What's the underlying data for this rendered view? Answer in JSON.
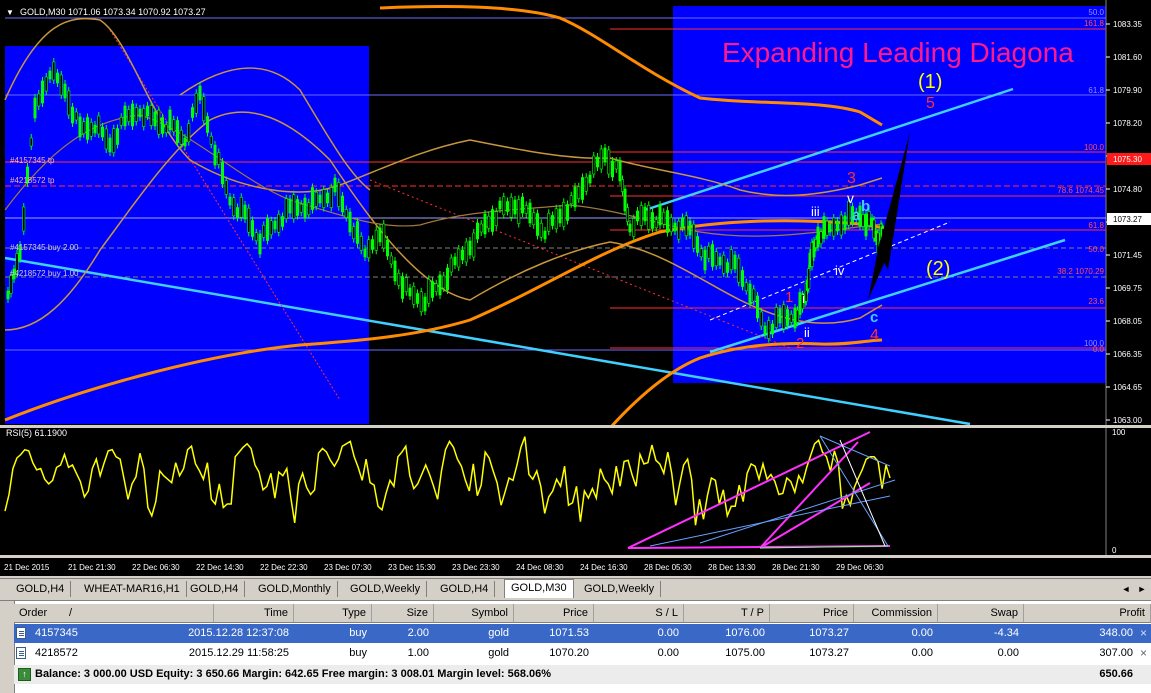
{
  "chart": {
    "header": "GOLD,M30  1071.06 1073.34 1070.92 1073.27",
    "title_overlay": "Expanding Leading Diagona",
    "price_axis": [
      "1083.35",
      "1081.60",
      "1079.90",
      "1078.20",
      "1076.50",
      "1074.80",
      "1073.27",
      "1071.45",
      "1069.75",
      "1068.05",
      "1066.35",
      "1064.65",
      "1063.00"
    ],
    "current_price": "1073.27",
    "current_price_box": "1075.30",
    "fib_labels": [
      "50.0",
      "161.8",
      "61.8",
      "100.0",
      "78.6 1074.45",
      "61.8",
      "50.0",
      "38.2 1070.29",
      "23.6",
      "100.0",
      "0.0"
    ],
    "order_lines": [
      "#4157345 tp",
      "#4218572 tp",
      "#4157345 buy 2.00",
      "#4218572 buy 1.00"
    ],
    "wave_labels": {
      "w1": "(1)",
      "w2": "(2)",
      "w5": "5",
      "w3": "3",
      "w4": "4",
      "ri": "i",
      "rii": "ii",
      "riii": "iii",
      "riv": "iv",
      "rv": "v",
      "a": "a",
      "b": "b",
      "c": "c",
      "one": "1",
      "two": "2"
    },
    "colors": {
      "blue_zone": "#0000ff",
      "ma_orange": "#ff8c00",
      "channel": "#40d0ff",
      "candles": "#00ff00",
      "wave_red": "#ff3030",
      "overlay_text": "#ff1a8c"
    }
  },
  "rsi": {
    "label": "RSI(5) 61.1900",
    "axis": [
      "100",
      "0"
    ],
    "values": [
      33,
      47,
      69,
      78,
      81,
      85,
      84,
      74,
      68,
      69,
      60,
      56,
      59,
      70,
      72,
      81,
      70,
      72,
      65,
      58,
      45,
      50,
      69,
      77,
      63,
      74,
      84,
      85,
      79,
      77,
      60,
      43,
      56,
      62,
      82,
      69,
      36,
      29,
      41,
      67,
      63,
      60,
      57,
      74,
      63,
      69,
      85,
      88,
      73,
      67,
      60,
      74,
      43,
      39,
      56,
      36,
      39,
      39,
      79,
      83,
      87,
      90,
      86,
      72,
      66,
      51,
      54,
      65,
      44,
      66,
      63,
      69,
      45,
      23,
      56,
      65,
      53,
      47,
      51,
      82,
      86,
      83,
      76,
      71,
      77,
      88,
      90,
      92,
      79,
      70,
      59,
      77,
      57,
      55,
      37,
      34,
      48,
      59,
      54,
      79,
      83,
      88,
      63,
      52,
      56,
      64,
      72,
      64,
      54,
      43,
      67,
      85,
      92,
      87,
      77,
      71,
      59,
      50,
      73,
      46,
      55,
      83,
      78,
      67,
      57,
      38,
      49,
      61,
      59,
      72,
      87,
      96,
      64,
      60,
      67,
      54,
      31,
      45,
      50,
      60,
      54,
      71,
      38,
      40,
      54,
      24,
      50,
      44,
      52,
      44,
      69,
      60,
      56,
      48,
      71,
      54,
      75,
      76,
      64,
      54,
      81,
      73,
      74,
      89,
      76,
      73,
      65,
      83,
      65,
      38,
      56,
      72,
      77,
      60,
      21,
      43,
      26,
      46,
      61,
      59,
      39,
      51,
      29,
      37,
      37,
      55,
      41,
      65,
      73,
      71,
      60,
      73,
      60,
      64,
      58,
      47,
      48,
      61,
      58,
      49,
      63,
      57,
      70,
      80,
      90,
      93,
      83,
      79,
      67,
      84,
      73,
      35,
      46,
      38,
      53,
      61,
      68,
      77,
      79,
      79,
      75,
      52,
      72,
      61
    ]
  },
  "time_axis": [
    "21 Dec 2015",
    "21 Dec 21:30",
    "22 Dec 06:30",
    "22 Dec 14:30",
    "22 Dec 22:30",
    "23 Dec 07:30",
    "23 Dec 15:30",
    "23 Dec 23:30",
    "24 Dec 08:30",
    "24 Dec 16:30",
    "28 Dec 05:30",
    "28 Dec 13:30",
    "28 Dec 21:30",
    "29 Dec 06:30"
  ],
  "tabs": [
    "GOLD,H4",
    "WHEAT-MAR16,H1",
    "GOLD,H4",
    "GOLD,Monthly",
    "GOLD,Weekly",
    "GOLD,H4",
    "GOLD,M30",
    "GOLD,Weekly"
  ],
  "active_tab": 6,
  "scroll": {
    "left": "◄",
    "right": "►"
  },
  "terminal": {
    "headers": [
      "Order",
      "/",
      "Time",
      "Type",
      "Size",
      "Symbol",
      "Price",
      "S / L",
      "T / P",
      "Price",
      "Commission",
      "Swap",
      "Profit"
    ],
    "rows": [
      {
        "order": "4157345",
        "time": "2015.12.28 12:37:08",
        "type": "buy",
        "size": "2.00",
        "symbol": "gold",
        "price": "1071.53",
        "sl": "0.00",
        "tp": "1076.00",
        "cur": "1073.27",
        "commission": "0.00",
        "swap": "-4.34",
        "profit": "348.00",
        "close": "×"
      },
      {
        "order": "4218572",
        "time": "2015.12.29 11:58:25",
        "type": "buy",
        "size": "1.00",
        "symbol": "gold",
        "price": "1070.20",
        "sl": "0.00",
        "tp": "1075.00",
        "cur": "1073.27",
        "commission": "0.00",
        "swap": "0.00",
        "profit": "307.00",
        "close": "×"
      }
    ],
    "balance": "Balance: 3 000.00 USD  Equity: 3 650.66  Margin: 642.65  Free margin: 3 008.01  Margin level: 568.06%",
    "balance_profit": "650.66"
  }
}
